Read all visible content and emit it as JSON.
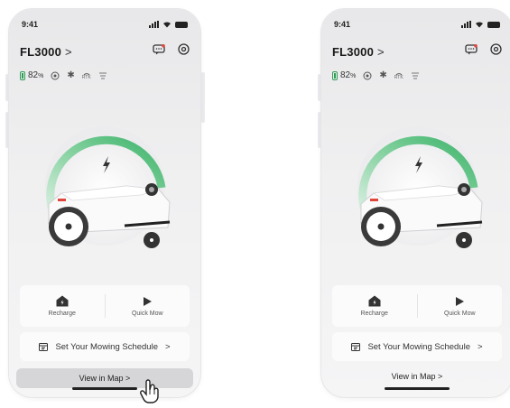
{
  "screens": [
    {
      "status": {
        "time": "9:41"
      },
      "header": {
        "model": "FL3000",
        "chevron": ">"
      },
      "info": {
        "battery_value": "82",
        "battery_unit": "%",
        "rtk": "RTK"
      },
      "actions": {
        "recharge": "Recharge",
        "quick_mow": "Quick Mow"
      },
      "schedule": {
        "label": "Set Your Mowing Schedule",
        "chevron": ">"
      },
      "map": {
        "label": "View in Map",
        "chevron": ">"
      }
    },
    {
      "status": {
        "time": "9:41"
      },
      "header": {
        "model": "FL3000",
        "chevron": ">"
      },
      "info": {
        "battery_value": "82",
        "battery_unit": "%",
        "rtk": "RTK"
      },
      "actions": {
        "recharge": "Recharge",
        "quick_mow": "Quick Mow"
      },
      "schedule": {
        "label": "Set Your Mowing Schedule",
        "chevron": ">"
      },
      "map": {
        "label": "View in Map",
        "chevron": ">"
      }
    }
  ],
  "colors": {
    "accent_green": "#3cb36a",
    "alert_red": "#e0463c",
    "text_dark": "#1a1a1a"
  },
  "icons": [
    "signal-icon",
    "wifi-icon",
    "battery-icon",
    "message-icon",
    "settings-icon",
    "gps-icon",
    "bluetooth-icon",
    "rtk-icon",
    "lte-icon",
    "lightning-icon",
    "home-icon",
    "play-icon",
    "calendar-icon",
    "hand-cursor-icon"
  ]
}
